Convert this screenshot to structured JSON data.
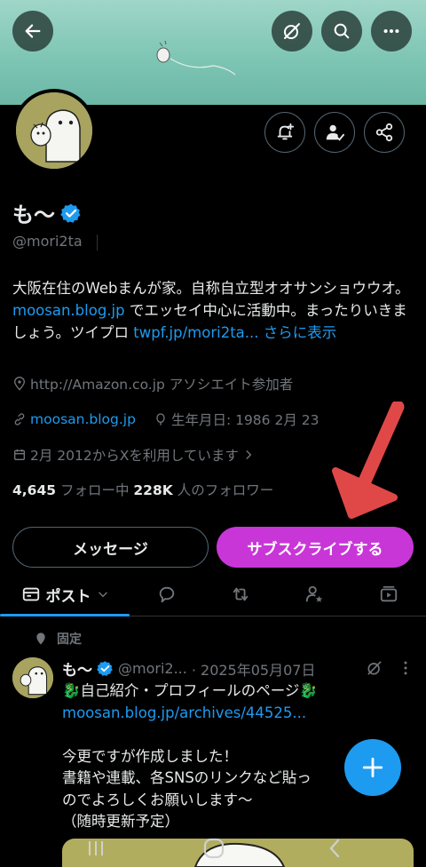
{
  "header": {
    "back_icon": "arrow-left-icon",
    "grok_icon": "grok-slash-icon",
    "search_icon": "search-icon",
    "more_icon": "more-horizontal-icon"
  },
  "profile_actions": {
    "notify_icon": "bell-plus-icon",
    "follow_icon": "person-check-icon",
    "share_icon": "share-icon"
  },
  "profile": {
    "name": "も〜",
    "handle": "@mori2ta",
    "verified": true,
    "bio_text_1": "大阪在住のWebまんが家。自称自立型オオサンショウウオ。",
    "bio_link_1": "moosan.blog.jp",
    "bio_text_2": " でエッセイ中心に活動中。まったりいきましょう。ツイプロ ",
    "bio_link_2": "twpf.jp/mori2ta...",
    "bio_more": " さらに表示",
    "location": "http://Amazon.co.jp アソシエイト参加者",
    "website": "moosan.blog.jp",
    "birthday": "生年月日: 1986 2月 23",
    "joined": "2月 2012からXを利用しています",
    "following_count": "4,645",
    "following_label": " フォロー中  ",
    "followers_count": "228K",
    "followers_label": " 人のフォロワー"
  },
  "buttons": {
    "message": "メッセージ",
    "subscribe": "サブスクライブする"
  },
  "tabs": {
    "posts_label": "ポスト"
  },
  "pinned_tweet": {
    "pinned_label": "固定",
    "author_name": "も〜",
    "author_handle": "@mori2...",
    "date": " · 2025年05月07日",
    "line1": "🐉自己紹介・プロフィールのページ🐉",
    "link": "moosan.blog.jp/archives/44525...",
    "line3": "今更ですが作成しました！",
    "line4": "書籍や連載、各SNSのリンクなど貼っ",
    "line5": "のでよろしくお願いします〜",
    "line6": "（随時更新予定）"
  },
  "colors": {
    "accent": "#1d9bf0",
    "subscribe": "#c936d8",
    "arrow": "#e04848"
  }
}
